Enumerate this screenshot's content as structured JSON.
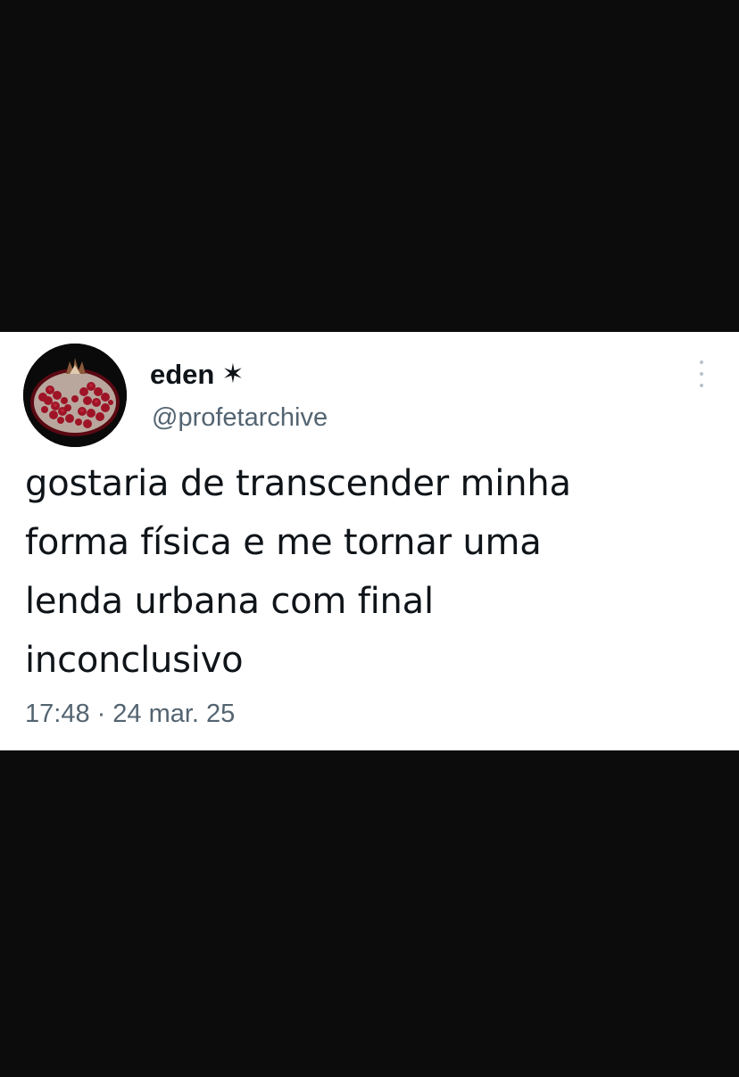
{
  "tweet": {
    "display_name": "eden",
    "name_icon": "asterisk-star-icon",
    "name_icon_glyph": "✶",
    "handle": "@profetarchive",
    "text_lines": [
      "gostaria de transcender minha",
      "forma física e me tornar uma",
      "lenda urbana com final",
      "inconclusivo"
    ],
    "time": "17:48",
    "separator": "·",
    "date": "24 mar. 25"
  },
  "colors": {
    "background": "#0c0c0c",
    "card": "#ffffff",
    "text_primary": "#0f1419",
    "text_secondary": "#536471",
    "pomegranate": "#8e1020"
  }
}
